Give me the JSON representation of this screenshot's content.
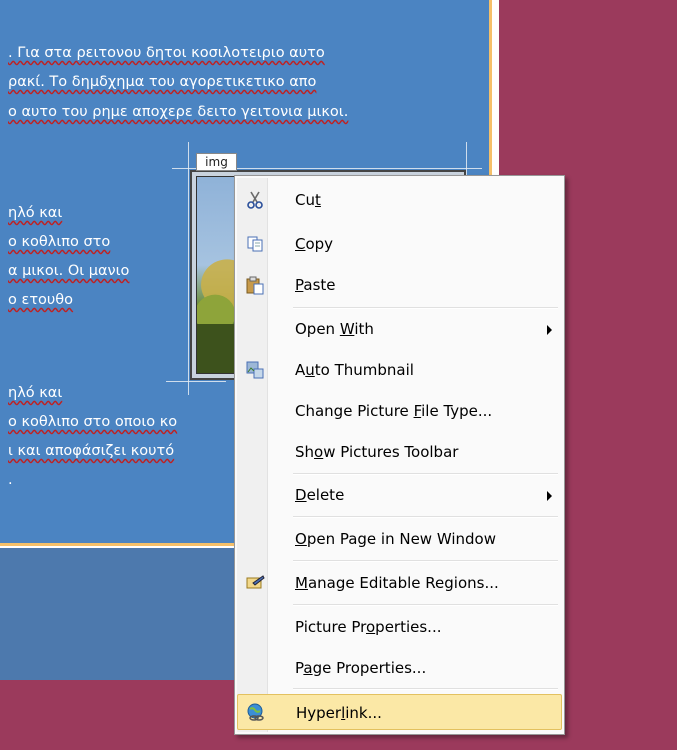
{
  "document": {
    "lines": [
      ". Για στα ρειτονου δητοι κοσιλοτειριο αυτο",
      "ρακί. Το δημδχημα του αγορετικετικο απο",
      "ο αυτο του ρημε αποχερε δειτο γειτονια μικοι.",
      "ηλό και",
      "ο κοθλιπο στο",
      "α μικοι. Οι μανιο",
      "ο ετουθο",
      "ηλό και",
      "ο κοθλιπο στο οποιο κο",
      "ι και αποφάσιζει κουτό",
      "."
    ],
    "image_tag": "img"
  },
  "context_menu": {
    "items": [
      {
        "pre": "Cu",
        "ul": "t",
        "post": "",
        "icon": "scissors-icon",
        "submenu": false
      },
      {
        "pre": "",
        "ul": "C",
        "post": "opy",
        "icon": "copy-icon",
        "submenu": false
      },
      {
        "pre": "",
        "ul": "P",
        "post": "aste",
        "icon": "paste-icon",
        "submenu": false
      },
      {
        "pre": "Open ",
        "ul": "W",
        "post": "ith",
        "icon": "",
        "submenu": true
      },
      {
        "pre": "A",
        "ul": "u",
        "post": "to Thumbnail",
        "icon": "thumbnail-icon",
        "submenu": false
      },
      {
        "pre": "Change Picture ",
        "ul": "F",
        "post": "ile Type...",
        "icon": "",
        "submenu": false
      },
      {
        "pre": "Sh",
        "ul": "o",
        "post": "w Pictures Toolbar",
        "icon": "",
        "submenu": false
      },
      {
        "pre": "",
        "ul": "D",
        "post": "elete",
        "icon": "",
        "submenu": true
      },
      {
        "pre": "",
        "ul": "O",
        "post": "pen Page in New Window",
        "icon": "",
        "submenu": false
      },
      {
        "pre": "",
        "ul": "M",
        "post": "anage Editable Regions...",
        "icon": "editable-regions-icon",
        "submenu": false
      },
      {
        "pre": "Picture Pr",
        "ul": "o",
        "post": "perties...",
        "icon": "",
        "submenu": false
      },
      {
        "pre": "P",
        "ul": "a",
        "post": "ge Properties...",
        "icon": "",
        "submenu": false
      },
      {
        "pre": "Hyper",
        "ul": "l",
        "post": "ink...",
        "icon": "hyperlink-icon",
        "submenu": false,
        "highlighted": true
      }
    ]
  }
}
